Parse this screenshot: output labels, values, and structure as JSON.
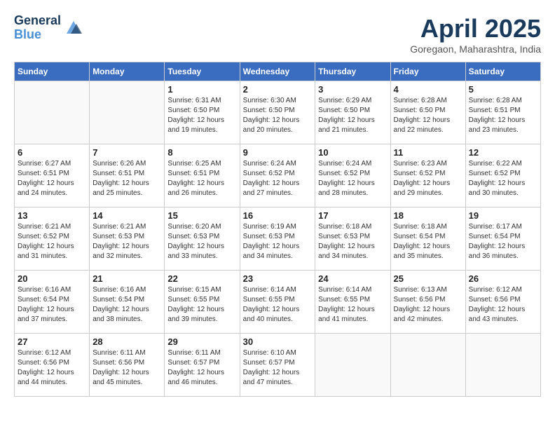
{
  "header": {
    "logo_line1": "General",
    "logo_line2": "Blue",
    "month_title": "April 2025",
    "location": "Goregaon, Maharashtra, India"
  },
  "days_of_week": [
    "Sunday",
    "Monday",
    "Tuesday",
    "Wednesday",
    "Thursday",
    "Friday",
    "Saturday"
  ],
  "weeks": [
    [
      {
        "day": "",
        "sunrise": "",
        "sunset": "",
        "daylight": ""
      },
      {
        "day": "",
        "sunrise": "",
        "sunset": "",
        "daylight": ""
      },
      {
        "day": "1",
        "sunrise": "Sunrise: 6:31 AM",
        "sunset": "Sunset: 6:50 PM",
        "daylight": "Daylight: 12 hours and 19 minutes."
      },
      {
        "day": "2",
        "sunrise": "Sunrise: 6:30 AM",
        "sunset": "Sunset: 6:50 PM",
        "daylight": "Daylight: 12 hours and 20 minutes."
      },
      {
        "day": "3",
        "sunrise": "Sunrise: 6:29 AM",
        "sunset": "Sunset: 6:50 PM",
        "daylight": "Daylight: 12 hours and 21 minutes."
      },
      {
        "day": "4",
        "sunrise": "Sunrise: 6:28 AM",
        "sunset": "Sunset: 6:50 PM",
        "daylight": "Daylight: 12 hours and 22 minutes."
      },
      {
        "day": "5",
        "sunrise": "Sunrise: 6:28 AM",
        "sunset": "Sunset: 6:51 PM",
        "daylight": "Daylight: 12 hours and 23 minutes."
      }
    ],
    [
      {
        "day": "6",
        "sunrise": "Sunrise: 6:27 AM",
        "sunset": "Sunset: 6:51 PM",
        "daylight": "Daylight: 12 hours and 24 minutes."
      },
      {
        "day": "7",
        "sunrise": "Sunrise: 6:26 AM",
        "sunset": "Sunset: 6:51 PM",
        "daylight": "Daylight: 12 hours and 25 minutes."
      },
      {
        "day": "8",
        "sunrise": "Sunrise: 6:25 AM",
        "sunset": "Sunset: 6:51 PM",
        "daylight": "Daylight: 12 hours and 26 minutes."
      },
      {
        "day": "9",
        "sunrise": "Sunrise: 6:24 AM",
        "sunset": "Sunset: 6:52 PM",
        "daylight": "Daylight: 12 hours and 27 minutes."
      },
      {
        "day": "10",
        "sunrise": "Sunrise: 6:24 AM",
        "sunset": "Sunset: 6:52 PM",
        "daylight": "Daylight: 12 hours and 28 minutes."
      },
      {
        "day": "11",
        "sunrise": "Sunrise: 6:23 AM",
        "sunset": "Sunset: 6:52 PM",
        "daylight": "Daylight: 12 hours and 29 minutes."
      },
      {
        "day": "12",
        "sunrise": "Sunrise: 6:22 AM",
        "sunset": "Sunset: 6:52 PM",
        "daylight": "Daylight: 12 hours and 30 minutes."
      }
    ],
    [
      {
        "day": "13",
        "sunrise": "Sunrise: 6:21 AM",
        "sunset": "Sunset: 6:52 PM",
        "daylight": "Daylight: 12 hours and 31 minutes."
      },
      {
        "day": "14",
        "sunrise": "Sunrise: 6:21 AM",
        "sunset": "Sunset: 6:53 PM",
        "daylight": "Daylight: 12 hours and 32 minutes."
      },
      {
        "day": "15",
        "sunrise": "Sunrise: 6:20 AM",
        "sunset": "Sunset: 6:53 PM",
        "daylight": "Daylight: 12 hours and 33 minutes."
      },
      {
        "day": "16",
        "sunrise": "Sunrise: 6:19 AM",
        "sunset": "Sunset: 6:53 PM",
        "daylight": "Daylight: 12 hours and 34 minutes."
      },
      {
        "day": "17",
        "sunrise": "Sunrise: 6:18 AM",
        "sunset": "Sunset: 6:53 PM",
        "daylight": "Daylight: 12 hours and 34 minutes."
      },
      {
        "day": "18",
        "sunrise": "Sunrise: 6:18 AM",
        "sunset": "Sunset: 6:54 PM",
        "daylight": "Daylight: 12 hours and 35 minutes."
      },
      {
        "day": "19",
        "sunrise": "Sunrise: 6:17 AM",
        "sunset": "Sunset: 6:54 PM",
        "daylight": "Daylight: 12 hours and 36 minutes."
      }
    ],
    [
      {
        "day": "20",
        "sunrise": "Sunrise: 6:16 AM",
        "sunset": "Sunset: 6:54 PM",
        "daylight": "Daylight: 12 hours and 37 minutes."
      },
      {
        "day": "21",
        "sunrise": "Sunrise: 6:16 AM",
        "sunset": "Sunset: 6:54 PM",
        "daylight": "Daylight: 12 hours and 38 minutes."
      },
      {
        "day": "22",
        "sunrise": "Sunrise: 6:15 AM",
        "sunset": "Sunset: 6:55 PM",
        "daylight": "Daylight: 12 hours and 39 minutes."
      },
      {
        "day": "23",
        "sunrise": "Sunrise: 6:14 AM",
        "sunset": "Sunset: 6:55 PM",
        "daylight": "Daylight: 12 hours and 40 minutes."
      },
      {
        "day": "24",
        "sunrise": "Sunrise: 6:14 AM",
        "sunset": "Sunset: 6:55 PM",
        "daylight": "Daylight: 12 hours and 41 minutes."
      },
      {
        "day": "25",
        "sunrise": "Sunrise: 6:13 AM",
        "sunset": "Sunset: 6:56 PM",
        "daylight": "Daylight: 12 hours and 42 minutes."
      },
      {
        "day": "26",
        "sunrise": "Sunrise: 6:12 AM",
        "sunset": "Sunset: 6:56 PM",
        "daylight": "Daylight: 12 hours and 43 minutes."
      }
    ],
    [
      {
        "day": "27",
        "sunrise": "Sunrise: 6:12 AM",
        "sunset": "Sunset: 6:56 PM",
        "daylight": "Daylight: 12 hours and 44 minutes."
      },
      {
        "day": "28",
        "sunrise": "Sunrise: 6:11 AM",
        "sunset": "Sunset: 6:56 PM",
        "daylight": "Daylight: 12 hours and 45 minutes."
      },
      {
        "day": "29",
        "sunrise": "Sunrise: 6:11 AM",
        "sunset": "Sunset: 6:57 PM",
        "daylight": "Daylight: 12 hours and 46 minutes."
      },
      {
        "day": "30",
        "sunrise": "Sunrise: 6:10 AM",
        "sunset": "Sunset: 6:57 PM",
        "daylight": "Daylight: 12 hours and 47 minutes."
      },
      {
        "day": "",
        "sunrise": "",
        "sunset": "",
        "daylight": ""
      },
      {
        "day": "",
        "sunrise": "",
        "sunset": "",
        "daylight": ""
      },
      {
        "day": "",
        "sunrise": "",
        "sunset": "",
        "daylight": ""
      }
    ]
  ]
}
